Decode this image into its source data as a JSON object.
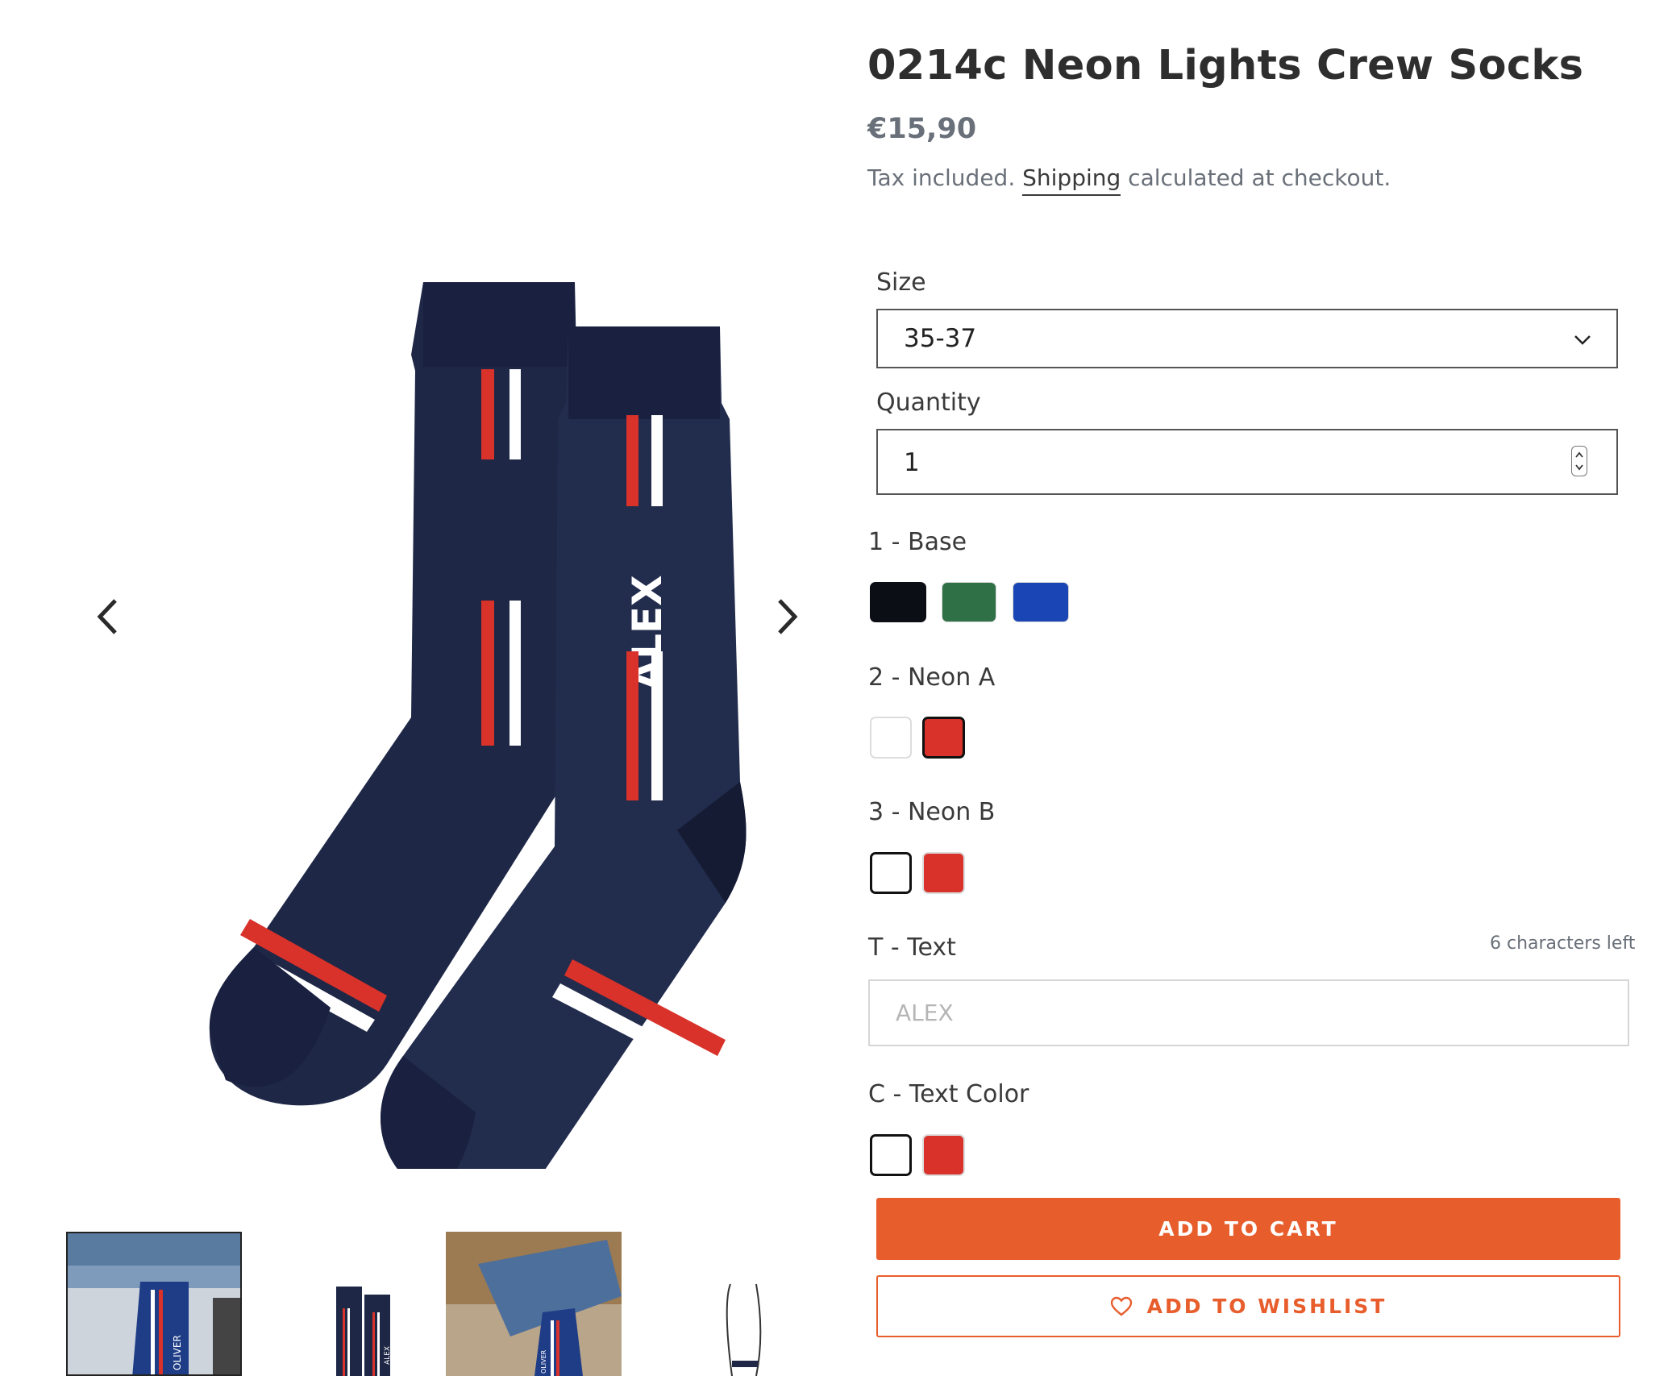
{
  "product": {
    "title": "0214c Neon Lights Crew Socks",
    "price": "€15,90",
    "tax_prefix": "Tax included. ",
    "shipping_link": "Shipping",
    "tax_suffix": " calculated at checkout."
  },
  "gallery": {
    "main_image_text": "ALEX",
    "prev_icon": "chevron-left-icon",
    "next_icon": "chevron-right-icon",
    "thumbnails": [
      {
        "name": "thumbnail-1",
        "text": "OLIVER",
        "selected": true
      },
      {
        "name": "thumbnail-2",
        "text": "ALEX",
        "selected": false
      },
      {
        "name": "thumbnail-3",
        "text": "OLIVER",
        "selected": false
      },
      {
        "name": "thumbnail-4",
        "selected": false
      }
    ]
  },
  "form": {
    "size_label": "Size",
    "size_value": "35-37",
    "quantity_label": "Quantity",
    "quantity_value": "1",
    "base_label": "1 - Base",
    "neon_a_label": "2 - Neon A",
    "neon_b_label": "3 - Neon B",
    "text_label": "T - Text",
    "text_counter": "6 characters left",
    "text_placeholder": "ALEX",
    "text_color_label": "C - Text Color"
  },
  "swatches": {
    "base": [
      "#0b0e14",
      "#2f7047",
      "#1a45b4"
    ],
    "neon_a": [
      "#ffffff",
      "#d8322a"
    ],
    "neon_b": [
      "#ffffff",
      "#d8322a"
    ],
    "text_color": [
      "#ffffff",
      "#d8322a"
    ]
  },
  "buttons": {
    "add_to_cart": "ADD TO CART",
    "add_to_wishlist": "ADD TO WISHLIST",
    "wishlist_icon": "heart-icon"
  },
  "colors": {
    "accent": "#e85d2c",
    "sock_navy": "#1e2746",
    "stripe_red": "#d8322a",
    "stripe_white": "#ffffff"
  }
}
